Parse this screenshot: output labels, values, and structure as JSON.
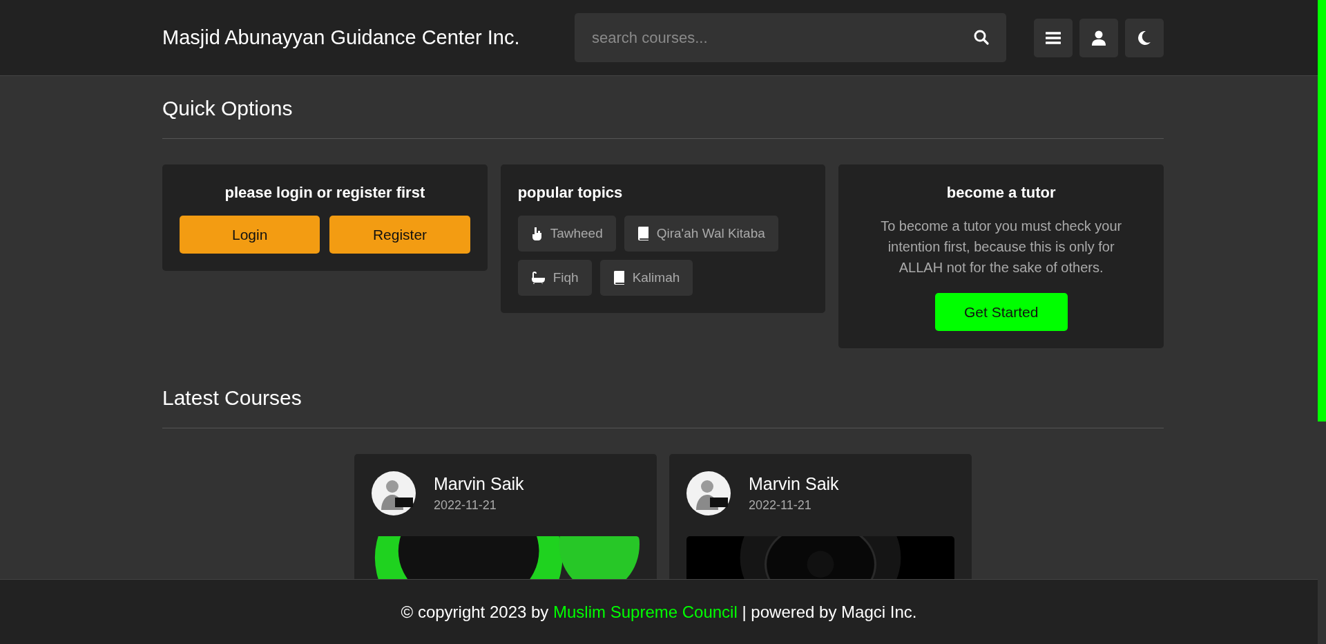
{
  "header": {
    "title": "Masjid Abunayyan Guidance Center Inc.",
    "search": {
      "placeholder": "search courses..."
    }
  },
  "quick_options": {
    "heading": "Quick Options",
    "login_card": {
      "title": "please login or register first",
      "buttons": [
        "Login",
        "Register"
      ]
    },
    "topics_card": {
      "title": "popular topics",
      "topics": [
        {
          "label": "Tawheed"
        },
        {
          "label": "Qira'ah Wal Kitaba"
        },
        {
          "label": "Fiqh"
        },
        {
          "label": "Kalimah"
        }
      ]
    },
    "tutor_card": {
      "title": "become a tutor",
      "text": "To become a tutor you must check your intention first, because this is only for ALLAH not for the sake of others.",
      "button": "Get Started"
    }
  },
  "latest_courses": {
    "heading": "Latest Courses",
    "courses": [
      {
        "author": "Marvin Saik",
        "date": "2022-11-21"
      },
      {
        "author": "Marvin Saik",
        "date": "2022-11-21"
      }
    ]
  },
  "footer": {
    "before": "© copyright 2023 by",
    "link": "Muslim Supreme Council",
    "after": "| powered by Magci Inc."
  }
}
